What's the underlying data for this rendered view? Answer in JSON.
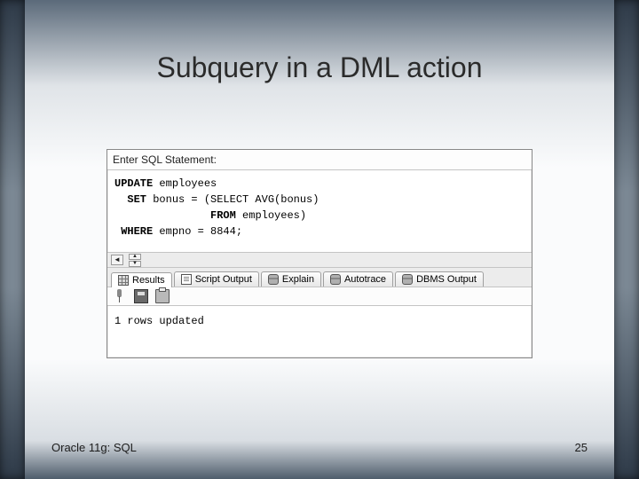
{
  "title": "Subquery in a DML action",
  "window": {
    "header": "Enter SQL Statement:",
    "sql_lines": [
      {
        "pre": "",
        "kw": "UPDATE",
        "rest": " employees"
      },
      {
        "pre": "  ",
        "kw": "SET",
        "rest": " bonus = (SELECT AVG(bonus)"
      },
      {
        "pre": "               ",
        "kw": "FROM",
        "rest": " employees)"
      },
      {
        "pre": " ",
        "kw": "WHERE",
        "rest": " empno = 8844;"
      }
    ],
    "tabs": [
      {
        "label": "Results",
        "icon": "grid-icon",
        "active": true
      },
      {
        "label": "Script Output",
        "icon": "doc-icon",
        "active": false
      },
      {
        "label": "Explain",
        "icon": "db-icon",
        "active": false
      },
      {
        "label": "Autotrace",
        "icon": "db-icon",
        "active": false
      },
      {
        "label": "DBMS Output",
        "icon": "db-icon",
        "active": false
      }
    ],
    "output_text": "1 rows updated"
  },
  "footer": {
    "left": "Oracle 11g: SQL",
    "right": "25"
  }
}
